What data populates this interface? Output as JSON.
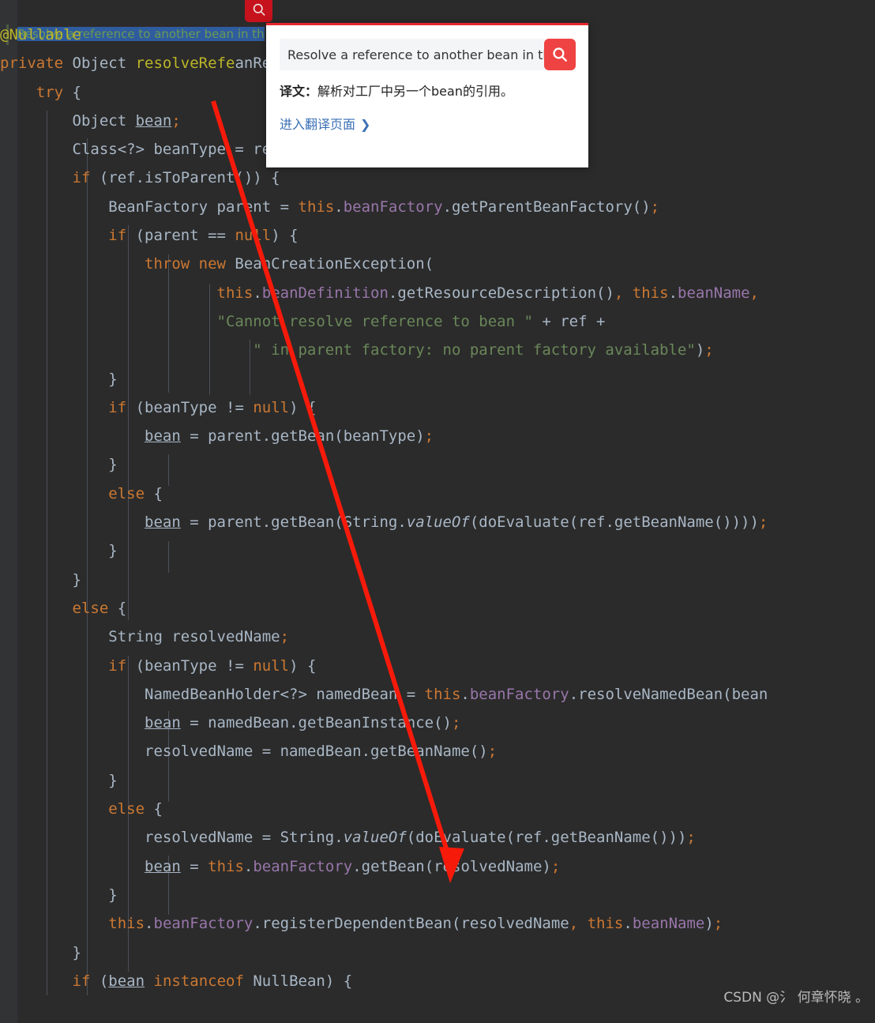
{
  "editor": {
    "selected_comment": "Resolve a reference to another bean in th",
    "code_lines": [
      {
        "indent": 0,
        "tokens": [
          {
            "t": "@Nullable",
            "c": "ann"
          }
        ]
      },
      {
        "indent": 0,
        "tokens": [
          {
            "t": "private ",
            "c": "kw"
          },
          {
            "t": "Object ",
            "c": "type"
          },
          {
            "t": "resolveRefe",
            "c": "ann"
          },
          {
            "t": "anReference ref) {",
            "c": "type"
          }
        ]
      },
      {
        "indent": 1,
        "tokens": [
          {
            "t": "try",
            "c": "kw"
          },
          {
            "t": " {",
            "c": "type"
          }
        ]
      },
      {
        "indent": 2,
        "tokens": [
          {
            "t": "Object ",
            "c": "type"
          },
          {
            "t": "bean",
            "c": "und"
          },
          {
            "t": ";",
            "c": "sem"
          }
        ]
      },
      {
        "indent": 2,
        "tokens": [
          {
            "t": "Class<?> beanType = ref.getBeanType()",
            "c": "type"
          },
          {
            "t": ";",
            "c": "sem"
          }
        ]
      },
      {
        "indent": 2,
        "tokens": [
          {
            "t": "if",
            "c": "kw"
          },
          {
            "t": " (ref.isToParent()) {",
            "c": "type"
          }
        ]
      },
      {
        "indent": 3,
        "tokens": [
          {
            "t": "BeanFactory parent = ",
            "c": "type"
          },
          {
            "t": "this",
            "c": "kw"
          },
          {
            "t": ".",
            "c": "type"
          },
          {
            "t": "beanFactory",
            "c": "fld"
          },
          {
            "t": ".getParentBeanFactory()",
            "c": "type"
          },
          {
            "t": ";",
            "c": "sem"
          }
        ]
      },
      {
        "indent": 3,
        "tokens": [
          {
            "t": "if",
            "c": "kw"
          },
          {
            "t": " (parent == ",
            "c": "type"
          },
          {
            "t": "null",
            "c": "kw"
          },
          {
            "t": ") {",
            "c": "type"
          }
        ]
      },
      {
        "indent": 4,
        "tokens": [
          {
            "t": "throw new ",
            "c": "kw"
          },
          {
            "t": "BeanCreationException(",
            "c": "type"
          }
        ]
      },
      {
        "indent": 6,
        "tokens": [
          {
            "t": "this",
            "c": "kw"
          },
          {
            "t": ".",
            "c": "type"
          },
          {
            "t": "beanDefinition",
            "c": "fld"
          },
          {
            "t": ".getResourceDescription()",
            "c": "type"
          },
          {
            "t": ", ",
            "c": "sem"
          },
          {
            "t": "this",
            "c": "kw"
          },
          {
            "t": ".",
            "c": "type"
          },
          {
            "t": "beanName",
            "c": "fld"
          },
          {
            "t": ",",
            "c": "sem"
          }
        ]
      },
      {
        "indent": 6,
        "tokens": [
          {
            "t": "\"Cannot resolve reference to bean \"",
            "c": "str"
          },
          {
            "t": " + ref +",
            "c": "type"
          }
        ]
      },
      {
        "indent": 7,
        "tokens": [
          {
            "t": "\" in parent factory: no parent factory available\"",
            "c": "str"
          },
          {
            "t": ")",
            "c": "type"
          },
          {
            "t": ";",
            "c": "sem"
          }
        ]
      },
      {
        "indent": 3,
        "tokens": [
          {
            "t": "}",
            "c": "type"
          }
        ]
      },
      {
        "indent": 3,
        "tokens": [
          {
            "t": "if",
            "c": "kw"
          },
          {
            "t": " (beanType != ",
            "c": "type"
          },
          {
            "t": "null",
            "c": "kw"
          },
          {
            "t": ") {",
            "c": "type"
          }
        ]
      },
      {
        "indent": 4,
        "tokens": [
          {
            "t": "bean",
            "c": "und"
          },
          {
            "t": " = parent.getBean(beanType)",
            "c": "type"
          },
          {
            "t": ";",
            "c": "sem"
          }
        ]
      },
      {
        "indent": 3,
        "tokens": [
          {
            "t": "}",
            "c": "type"
          }
        ]
      },
      {
        "indent": 3,
        "tokens": [
          {
            "t": "else",
            "c": "kw"
          },
          {
            "t": " {",
            "c": "type"
          }
        ]
      },
      {
        "indent": 4,
        "tokens": [
          {
            "t": "bean",
            "c": "und"
          },
          {
            "t": " = parent.getBean(String.",
            "c": "type"
          },
          {
            "t": "valueOf",
            "c": "stat"
          },
          {
            "t": "(doEvaluate(ref.getBeanName())))",
            "c": "type"
          },
          {
            "t": ";",
            "c": "sem"
          }
        ]
      },
      {
        "indent": 3,
        "tokens": [
          {
            "t": "}",
            "c": "type"
          }
        ]
      },
      {
        "indent": 2,
        "tokens": [
          {
            "t": "}",
            "c": "type"
          }
        ]
      },
      {
        "indent": 2,
        "tokens": [
          {
            "t": "else",
            "c": "kw"
          },
          {
            "t": " {",
            "c": "type"
          }
        ]
      },
      {
        "indent": 3,
        "tokens": [
          {
            "t": "String resolvedName",
            "c": "type"
          },
          {
            "t": ";",
            "c": "sem"
          }
        ]
      },
      {
        "indent": 3,
        "tokens": [
          {
            "t": "if",
            "c": "kw"
          },
          {
            "t": " (beanType != ",
            "c": "type"
          },
          {
            "t": "null",
            "c": "kw"
          },
          {
            "t": ") {",
            "c": "type"
          }
        ]
      },
      {
        "indent": 4,
        "tokens": [
          {
            "t": "NamedBeanHolder<?> namedBean = ",
            "c": "type"
          },
          {
            "t": "this",
            "c": "kw"
          },
          {
            "t": ".",
            "c": "type"
          },
          {
            "t": "beanFactory",
            "c": "fld"
          },
          {
            "t": ".resolveNamedBean(bean",
            "c": "type"
          }
        ]
      },
      {
        "indent": 4,
        "tokens": [
          {
            "t": "bean",
            "c": "und"
          },
          {
            "t": " = namedBean.getBeanInstance()",
            "c": "type"
          },
          {
            "t": ";",
            "c": "sem"
          }
        ]
      },
      {
        "indent": 4,
        "tokens": [
          {
            "t": "resolvedName = namedBean.getBeanName()",
            "c": "type"
          },
          {
            "t": ";",
            "c": "sem"
          }
        ]
      },
      {
        "indent": 3,
        "tokens": [
          {
            "t": "}",
            "c": "type"
          }
        ]
      },
      {
        "indent": 3,
        "tokens": [
          {
            "t": "else",
            "c": "kw"
          },
          {
            "t": " {",
            "c": "type"
          }
        ]
      },
      {
        "indent": 4,
        "tokens": [
          {
            "t": "resolvedName = String.",
            "c": "type"
          },
          {
            "t": "valueOf",
            "c": "stat"
          },
          {
            "t": "(doEvaluate(ref.getBeanName()))",
            "c": "type"
          },
          {
            "t": ";",
            "c": "sem"
          }
        ]
      },
      {
        "indent": 4,
        "tokens": [
          {
            "t": "bean",
            "c": "und"
          },
          {
            "t": " = ",
            "c": "type"
          },
          {
            "t": "this",
            "c": "kw"
          },
          {
            "t": ".",
            "c": "type"
          },
          {
            "t": "beanFactory",
            "c": "fld"
          },
          {
            "t": ".getBean(resolvedName)",
            "c": "type"
          },
          {
            "t": ";",
            "c": "sem"
          }
        ]
      },
      {
        "indent": 3,
        "tokens": [
          {
            "t": "}",
            "c": "type"
          }
        ]
      },
      {
        "indent": 3,
        "tokens": [
          {
            "t": "this",
            "c": "kw"
          },
          {
            "t": ".",
            "c": "type"
          },
          {
            "t": "beanFactory",
            "c": "fld"
          },
          {
            "t": ".registerDependentBean(resolvedName",
            "c": "type"
          },
          {
            "t": ", ",
            "c": "sem"
          },
          {
            "t": "this",
            "c": "kw"
          },
          {
            "t": ".",
            "c": "type"
          },
          {
            "t": "beanName",
            "c": "fld"
          },
          {
            "t": ")",
            "c": "type"
          },
          {
            "t": ";",
            "c": "sem"
          }
        ]
      },
      {
        "indent": 2,
        "tokens": [
          {
            "t": "}",
            "c": "type"
          }
        ]
      },
      {
        "indent": 2,
        "tokens": [
          {
            "t": "if",
            "c": "kw"
          },
          {
            "t": " (",
            "c": "type"
          },
          {
            "t": "bean",
            "c": "und"
          },
          {
            "t": " ",
            "c": "type"
          },
          {
            "t": "instanceof",
            "c": "kw"
          },
          {
            "t": " NullBean) {",
            "c": "type"
          }
        ]
      }
    ]
  },
  "popup": {
    "search_input_value": "Resolve a reference to another bean in the fa",
    "search_input_placeholder": "",
    "search_button_icon": "search-icon",
    "translation_label": "译文：",
    "translation_text": "解析对工厂中另一个bean的引用。",
    "link_text": "进入翻译页面",
    "link_chevron": "❯",
    "accent_color": "#e8252d",
    "button_color": "#ef4343"
  },
  "search_chip": {
    "icon": "search-icon",
    "color": "#c5121c"
  },
  "watermark": {
    "text": "CSDN @氵 何章怀晓 。"
  }
}
